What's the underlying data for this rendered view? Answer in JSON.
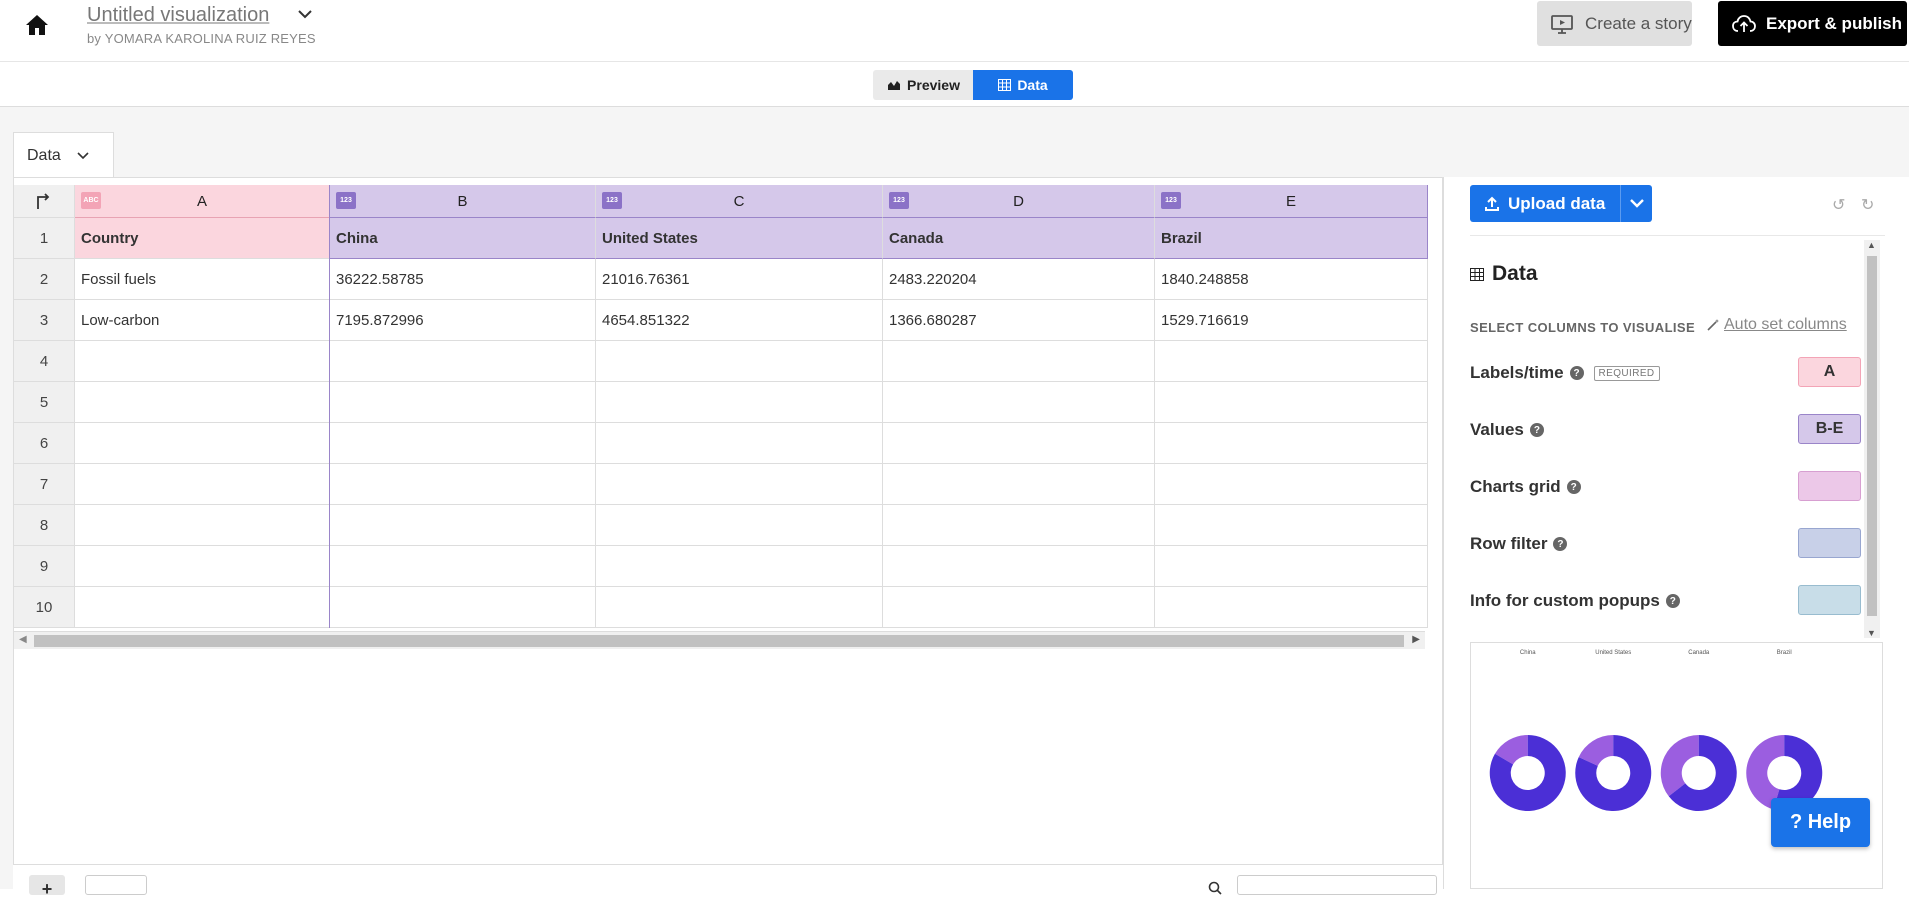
{
  "header": {
    "title": "Untitled visualization",
    "byline": "by YOMARA KAROLINA RUIZ REYES",
    "create_story": "Create a story",
    "export_publish": "Export & publish"
  },
  "toggle": {
    "preview": "Preview",
    "data": "Data",
    "active": "Data"
  },
  "sheet_tab": "Data",
  "grid": {
    "columns": [
      {
        "letter": "A",
        "type_badge": "ABC"
      },
      {
        "letter": "B",
        "type_badge": "123"
      },
      {
        "letter": "C",
        "type_badge": "123"
      },
      {
        "letter": "D",
        "type_badge": "123"
      },
      {
        "letter": "E",
        "type_badge": "123"
      }
    ],
    "rows": [
      {
        "num": "1",
        "cells": [
          "Country",
          "China",
          "United States",
          "Canada",
          "Brazil"
        ]
      },
      {
        "num": "2",
        "cells": [
          "Fossil fuels",
          "36222.58785",
          "21016.76361",
          "2483.220204",
          "1840.248858"
        ]
      },
      {
        "num": "3",
        "cells": [
          "Low-carbon",
          "7195.872996",
          "4654.851322",
          "1366.680287",
          "1529.716619"
        ]
      },
      {
        "num": "4",
        "cells": [
          "",
          "",
          "",
          "",
          ""
        ]
      },
      {
        "num": "5",
        "cells": [
          "",
          "",
          "",
          "",
          ""
        ]
      },
      {
        "num": "6",
        "cells": [
          "",
          "",
          "",
          "",
          ""
        ]
      },
      {
        "num": "7",
        "cells": [
          "",
          "",
          "",
          "",
          ""
        ]
      },
      {
        "num": "8",
        "cells": [
          "",
          "",
          "",
          "",
          ""
        ]
      },
      {
        "num": "9",
        "cells": [
          "",
          "",
          "",
          "",
          ""
        ]
      },
      {
        "num": "10",
        "cells": [
          "",
          "",
          "",
          "",
          ""
        ]
      }
    ]
  },
  "right_panel": {
    "upload_data": "Upload data",
    "data_heading": "Data",
    "select_columns": "SELECT COLUMNS TO VISUALISE",
    "auto_set": "Auto set columns",
    "bindings": [
      {
        "label": "Labels/time",
        "required": "REQUIRED",
        "value": "A",
        "color": "#fbd6de"
      },
      {
        "label": "Values",
        "required": "",
        "value": "B-E",
        "color": "#d5c8ea"
      },
      {
        "label": "Charts grid",
        "required": "",
        "value": "",
        "color": "#ecc8e8"
      },
      {
        "label": "Row filter",
        "required": "",
        "value": "",
        "color": "#c8d0e8"
      },
      {
        "label": "Info for custom popups",
        "required": "",
        "value": "",
        "color": "#c8dde8"
      }
    ]
  },
  "chart_data": {
    "type": "pie",
    "charts": [
      {
        "title": "China",
        "values": [
          36222.58785,
          7195.872996
        ]
      },
      {
        "title": "United States",
        "values": [
          21016.76361,
          4654.851322
        ]
      },
      {
        "title": "Canada",
        "values": [
          2483.220204,
          1366.680287
        ]
      },
      {
        "title": "Brazil",
        "values": [
          1840.248858,
          1529.716619
        ]
      }
    ],
    "slice_labels": [
      "Fossil fuels",
      "Low-carbon"
    ],
    "colors": [
      "#4b2fd6",
      "#9b5ee0"
    ]
  },
  "help_button": "? Help"
}
